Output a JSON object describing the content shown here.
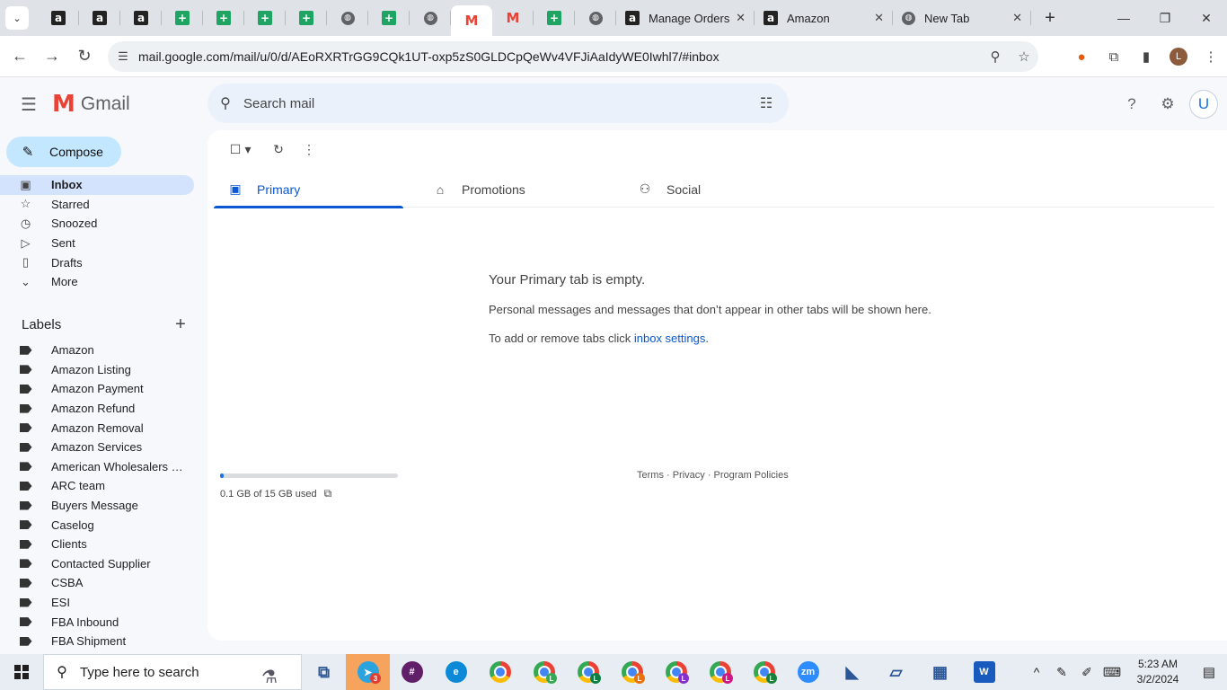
{
  "browser": {
    "tab_search_glyph": "⌄",
    "pinned_tabs": [
      {
        "icon": "amazon-icon",
        "glyph": "a",
        "kind": "amz"
      },
      {
        "icon": "amazon-icon",
        "glyph": "a",
        "kind": "amz"
      },
      {
        "icon": "amazon-icon",
        "glyph": "a",
        "kind": "amz"
      },
      {
        "icon": "sheets-icon",
        "glyph": "+",
        "kind": "sheet"
      },
      {
        "icon": "sheets-icon",
        "glyph": "+",
        "kind": "sheet"
      },
      {
        "icon": "sheets-icon",
        "glyph": "+",
        "kind": "sheet"
      },
      {
        "icon": "sheets-icon",
        "glyph": "+",
        "kind": "sheet"
      },
      {
        "icon": "globe-icon",
        "glyph": "◍",
        "kind": "globe"
      },
      {
        "icon": "sheets-icon",
        "glyph": "+",
        "kind": "sheet"
      },
      {
        "icon": "globe-icon",
        "glyph": "◍",
        "kind": "globe"
      },
      {
        "icon": "gmail-icon",
        "glyph": "M",
        "kind": "gmail",
        "active": true
      },
      {
        "icon": "gmail-icon",
        "glyph": "M",
        "kind": "gmail"
      },
      {
        "icon": "sheets-icon",
        "glyph": "+",
        "kind": "sheet"
      },
      {
        "icon": "globe-icon",
        "glyph": "◍",
        "kind": "globe"
      }
    ],
    "tabs": [
      {
        "title": "Manage Orders",
        "icon": "amazon-icon",
        "glyph": "a",
        "kind": "amz"
      },
      {
        "title": "Amazon",
        "icon": "amazon-icon",
        "glyph": "a",
        "kind": "amz"
      },
      {
        "title": "New Tab",
        "icon": "chrome-icon",
        "glyph": "◍",
        "kind": "globe"
      }
    ],
    "close_glyph": "✕",
    "new_tab_glyph": "+",
    "window_controls": {
      "minimize": "—",
      "restore": "❐",
      "close": "✕"
    },
    "url": "mail.google.com/mail/u/0/d/AEoRXRTrGG9CQk1UT-oxp5zS0GLDCpQeWv4VFJiAaIdyWE0Iwhl7/#inbox",
    "nav": {
      "back": "←",
      "forward": "→",
      "reload": "↻",
      "site_info": "☰"
    },
    "omni_icons": {
      "zoom": "⚲",
      "bookmark": "☆"
    },
    "profile_initial": "L"
  },
  "gmail": {
    "app_name": "Gmail",
    "logo_glyph": "M",
    "search_placeholder": "Search mail",
    "account_initial": "U",
    "compose_label": "Compose",
    "nav_items": [
      {
        "label": "Inbox",
        "icon": "inbox-icon",
        "glyph": "▣",
        "active": true
      },
      {
        "label": "Starred",
        "icon": "star-icon",
        "glyph": "☆"
      },
      {
        "label": "Snoozed",
        "icon": "clock-icon",
        "glyph": "◷"
      },
      {
        "label": "Sent",
        "icon": "send-icon",
        "glyph": "▷"
      },
      {
        "label": "Drafts",
        "icon": "draft-icon",
        "glyph": "▯"
      },
      {
        "label": "More",
        "icon": "chevron-down-icon",
        "glyph": "⌄"
      }
    ],
    "labels_heading": "Labels",
    "labels": [
      "Amazon",
      "Amazon Listing",
      "Amazon Payment",
      "Amazon Refund",
      "Amazon Removal",
      "Amazon Services",
      "American Wholesalers L...",
      "ARC team",
      "Buyers Message",
      "Caselog",
      "Clients",
      "Contacted Supplier",
      "CSBA",
      "ESI",
      "FBA Inbound",
      "FBA Shipment"
    ],
    "tabs": [
      {
        "label": "Primary",
        "icon": "inbox-tab-icon",
        "glyph": "▣",
        "active": true
      },
      {
        "label": "Promotions",
        "icon": "tag-icon",
        "glyph": "⌂"
      },
      {
        "label": "Social",
        "icon": "people-icon",
        "glyph": "⚇"
      }
    ],
    "empty_title": "Your Primary tab is empty.",
    "empty_line1": "Personal messages and messages that don’t appear in other tabs will be shown here.",
    "empty_line2_prefix": "To add or remove tabs click ",
    "empty_link": "inbox settings",
    "empty_line2_suffix": ".",
    "storage_text": "0.1 GB of 15 GB used",
    "storage_fraction": 0.0067,
    "footer": "Terms · Privacy · Program Policies"
  },
  "taskbar": {
    "search_placeholder": "Type here to search",
    "apps": [
      {
        "name": "task-view-icon",
        "glyph": "⧉",
        "kind": "plain"
      },
      {
        "name": "telegram-icon",
        "glyph": "➤",
        "kind": "telegram",
        "badge": "3"
      },
      {
        "name": "slack-icon",
        "glyph": "#",
        "kind": "slack"
      },
      {
        "name": "edge-icon",
        "glyph": "e",
        "kind": "edge"
      },
      {
        "name": "chrome-icon",
        "glyph": "",
        "kind": "chrome"
      },
      {
        "name": "chrome-profile-icon",
        "glyph": "",
        "kind": "chrome",
        "profile": "L",
        "pcolor": "#34a853"
      },
      {
        "name": "chrome-profile-icon",
        "glyph": "",
        "kind": "chrome",
        "profile": "L",
        "pcolor": "#0b8043"
      },
      {
        "name": "chrome-profile-icon",
        "glyph": "",
        "kind": "chrome",
        "profile": "L",
        "pcolor": "#e8710a"
      },
      {
        "name": "chrome-profile-icon",
        "glyph": "",
        "kind": "chrome",
        "profile": "L",
        "pcolor": "#8430ce"
      },
      {
        "name": "chrome-profile-icon",
        "glyph": "",
        "kind": "chrome",
        "profile": "L",
        "pcolor": "#d01884"
      },
      {
        "name": "chrome-profile-icon",
        "glyph": "",
        "kind": "chrome",
        "profile": "L",
        "pcolor": "#188038"
      },
      {
        "name": "zoom-icon",
        "glyph": "zm",
        "kind": "zoom"
      },
      {
        "name": "media-app-icon",
        "glyph": "◣",
        "kind": "plain"
      },
      {
        "name": "notepad-icon",
        "glyph": "▱",
        "kind": "plain"
      },
      {
        "name": "calculator-icon",
        "glyph": "▦",
        "kind": "plain"
      },
      {
        "name": "word-icon",
        "glyph": "W",
        "kind": "word"
      }
    ],
    "tray": [
      "^",
      "✎",
      "✐",
      "⌨"
    ],
    "time": "5:23 AM",
    "date": "3/2/2024",
    "notif_glyph": "▤"
  },
  "colors": {
    "accent": "#0b57d0",
    "compose_bg": "#c2e7ff",
    "active_nav_bg": "#d3e3fd",
    "telegram_hl": "#f6a35e"
  }
}
